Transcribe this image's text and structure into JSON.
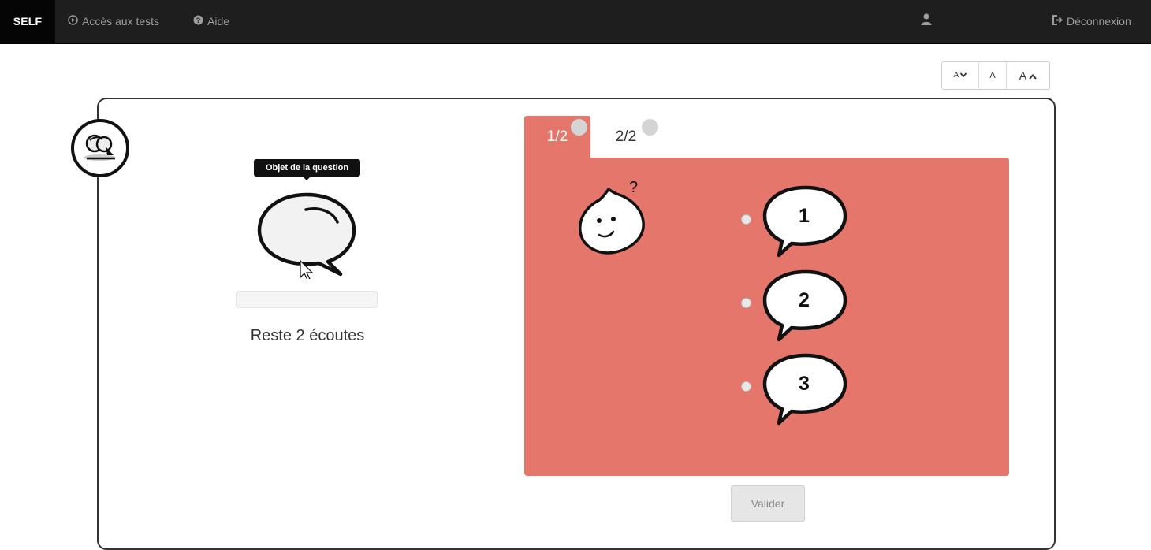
{
  "nav": {
    "brand": "SELF",
    "tests_label": "Accès aux tests",
    "help_label": "Aide",
    "logout_label": "Déconnexion"
  },
  "font_controls": {
    "decrease_label": "A",
    "normal_label": "A",
    "increase_label": "A"
  },
  "question": {
    "tooltip": "Objet de la question",
    "remaining_label": "Reste 2 écoutes",
    "listen_progress": 0
  },
  "tabs": [
    {
      "label": "1/2",
      "active": true
    },
    {
      "label": "2/2",
      "active": false
    }
  ],
  "options": [
    {
      "label": "1"
    },
    {
      "label": "2"
    },
    {
      "label": "3"
    }
  ],
  "submit_label": "Valider",
  "colors": {
    "navbar": "#1e1e1e",
    "answer_area": "#e5766b",
    "navbar_text": "#9d9d9d"
  }
}
